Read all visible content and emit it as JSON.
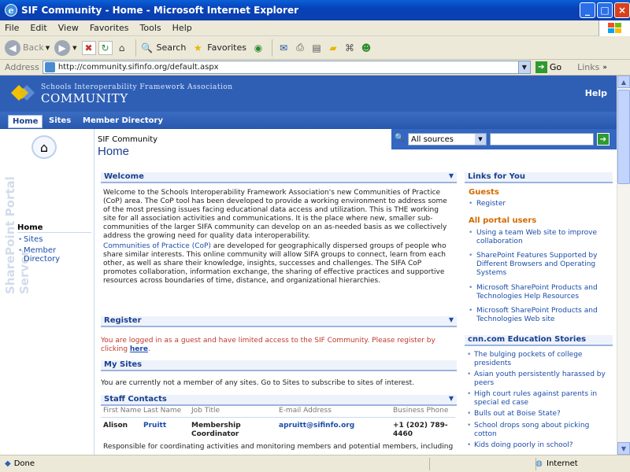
{
  "window": {
    "title": "SIF Community - Home - Microsoft Internet Explorer"
  },
  "menu": [
    "File",
    "Edit",
    "View",
    "Favorites",
    "Tools",
    "Help"
  ],
  "toolbar": {
    "back": "Back",
    "search": "Search",
    "favorites": "Favorites"
  },
  "address": {
    "label": "Address",
    "url": "http://community.sifinfo.org/default.aspx",
    "go": "Go",
    "links": "Links"
  },
  "site": {
    "org_name": "Schools Interoperability Framework Association",
    "community": "COMMUNITY",
    "help": "Help",
    "nav": {
      "home": "Home",
      "sites": "Sites",
      "member_directory": "Member Directory"
    }
  },
  "left_nav": {
    "title": "Home",
    "items": [
      "Sites",
      "Member Directory"
    ],
    "vertical_text": "SharePoint Portal Server"
  },
  "header": {
    "crumb": "SIF Community",
    "title": "Home"
  },
  "search": {
    "scope": "All sources",
    "value": ""
  },
  "welcome": {
    "title": "Welcome",
    "p1": "Welcome to the Schools Interoperability Framework Association's new Communities of Practice (CoP) area. The CoP tool has been developed to provide a working environment to address some of the most pressing issues facing educational data access and utilization. This is THE working site for all association activities and communications. It is the place where new, smaller sub-communities of the larger SIFA community can develop on an as-needed basis as we collectively address the growing need for quality data interoperability.",
    "p2_link": "Communities of Practice (CoP)",
    "p2": " are developed for geographically dispersed groups of people who share similar interests. This online community will allow SIFA groups to connect, learn from each other, as well as share their knowledge, insights, successes and challenges. The SIFA CoP promotes collaboration, information exchange, the sharing of effective practices and supportive resources across boundaries of time, distance, and organizational hierarchies."
  },
  "register": {
    "title": "Register",
    "text": "You are logged in as a guest and have limited access to the SIF Community. Please register by clicking ",
    "link": "here",
    "end": "."
  },
  "my_sites": {
    "title": "My Sites",
    "text": "You are currently not a member of any sites. Go to Sites to subscribe to sites of interest."
  },
  "staff": {
    "title": "Staff Contacts",
    "headers": [
      "First Name",
      "Last Name",
      "Job Title",
      "E-mail Address",
      "Business Phone"
    ],
    "row": {
      "first": "Alison",
      "last": "Pruitt",
      "job": "Membership Coordinator",
      "email": "apruitt@sifinfo.org",
      "phone": "+1 (202) 789-4460"
    },
    "desc": "Responsible for coordinating activities and monitoring members and potential members, including"
  },
  "links_for_you": {
    "title": "Links for You",
    "guests_title": "Guests",
    "guests": [
      "Register"
    ],
    "all_title": "All portal users",
    "all": [
      "Using a team Web site to improve collaboration",
      "SharePoint Features Supported by Different Browsers and Operating Systems",
      "Microsoft SharePoint Products and Technologies Help Resources",
      "Microsoft SharePoint Products and Technologies Web site"
    ]
  },
  "cnn": {
    "title": "cnn.com Education Stories",
    "items": [
      "The bulging pockets of college presidents",
      "Asian youth persistently harassed by peers",
      "High court rules against parents in special ed case",
      "Bulls out at Boise State?",
      "School drops song about picking cotton",
      "Kids doing poorly in school?"
    ]
  },
  "status": {
    "left": "Done",
    "zone": "Internet"
  },
  "colors": {
    "banner": "#2f5fb5",
    "link": "#1a4ca8",
    "accent": "#d46a00"
  }
}
